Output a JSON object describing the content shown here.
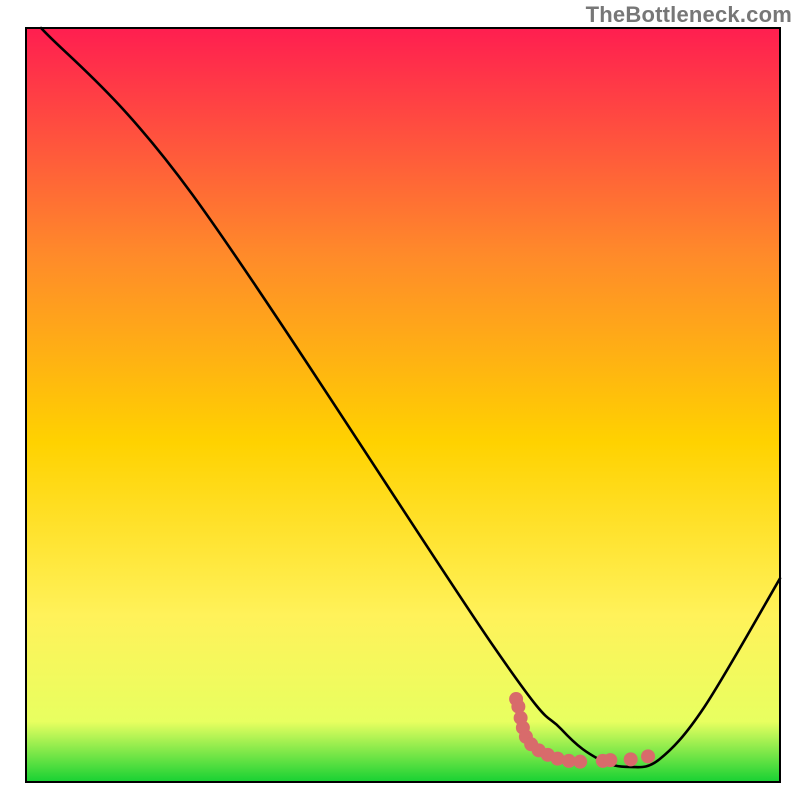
{
  "watermark": "TheBottleneck.com",
  "chart_data": {
    "type": "line",
    "title": "",
    "xlabel": "",
    "ylabel": "",
    "xlim": [
      0,
      100
    ],
    "ylim": [
      0,
      100
    ],
    "gradient_colors": {
      "top": "#ff1e50",
      "upper_mid": "#ff8a2a",
      "mid": "#ffd200",
      "lower_mid": "#fff25a",
      "low": "#e8ff60",
      "bottom": "#17d133"
    },
    "curve": {
      "description": "Bottleneck/mismatch magnitude vs. x; dips to a minimum near x≈80 then rises again.",
      "points": [
        {
          "x": 2.0,
          "y": 100.0
        },
        {
          "x": 22.0,
          "y": 78.0
        },
        {
          "x": 62.0,
          "y": 18.0
        },
        {
          "x": 71.0,
          "y": 7.0
        },
        {
          "x": 76.0,
          "y": 3.0
        },
        {
          "x": 80.0,
          "y": 2.0
        },
        {
          "x": 84.0,
          "y": 3.0
        },
        {
          "x": 90.0,
          "y": 10.0
        },
        {
          "x": 100.0,
          "y": 27.0
        }
      ]
    },
    "marker_cluster": {
      "color": "#d86b6b",
      "description": "Cluster of sample points around the curve minimum",
      "points": [
        {
          "x": 65.0,
          "y": 11.0
        },
        {
          "x": 65.3,
          "y": 10.0
        },
        {
          "x": 65.6,
          "y": 8.5
        },
        {
          "x": 65.9,
          "y": 7.2
        },
        {
          "x": 66.3,
          "y": 6.0
        },
        {
          "x": 67.0,
          "y": 5.0
        },
        {
          "x": 68.0,
          "y": 4.2
        },
        {
          "x": 69.2,
          "y": 3.6
        },
        {
          "x": 70.5,
          "y": 3.1
        },
        {
          "x": 72.0,
          "y": 2.8
        },
        {
          "x": 73.5,
          "y": 2.7
        },
        {
          "x": 76.5,
          "y": 2.8
        },
        {
          "x": 77.5,
          "y": 2.9
        },
        {
          "x": 80.2,
          "y": 3.0
        },
        {
          "x": 82.5,
          "y": 3.4
        }
      ]
    }
  }
}
